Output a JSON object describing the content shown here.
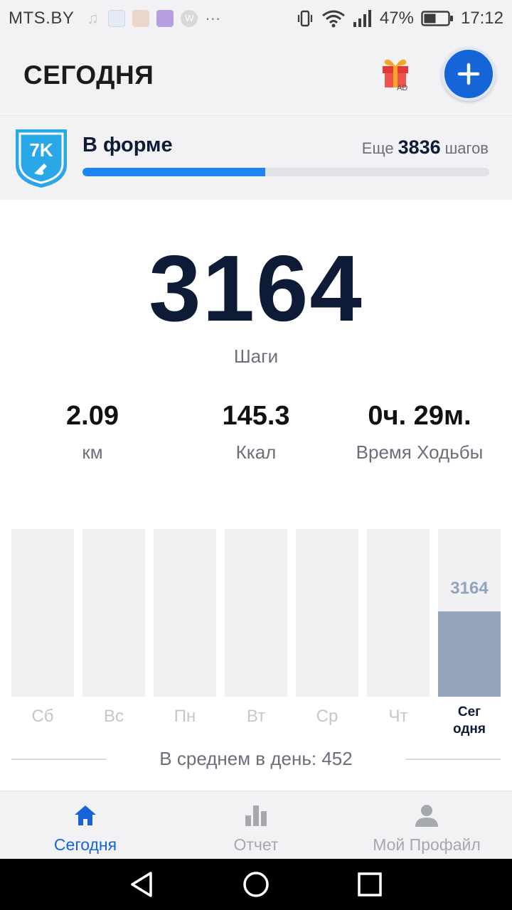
{
  "status_bar": {
    "carrier": "MTS.BY",
    "battery_percent": "47%",
    "time": "17:12",
    "notification_icons": [
      "music-icon",
      "app-icon",
      "photo-icon",
      "gallery-icon",
      "w-icon",
      "more-dots-icon"
    ],
    "system_icons": [
      "vibrate-icon",
      "wifi-icon",
      "signal-icon",
      "battery-icon"
    ]
  },
  "header": {
    "title": "СЕГОДНЯ",
    "gift_badge": "AD",
    "gift_icon": "gift-icon",
    "add_icon": "plus-icon"
  },
  "goal": {
    "badge_text": "7K",
    "name": "В форме",
    "remaining_prefix": "Еще",
    "remaining_steps": "3836",
    "remaining_suffix": "шагов",
    "progress_fraction": 0.45
  },
  "today": {
    "steps": "3164",
    "steps_label": "Шаги",
    "distance_value": "2.09",
    "distance_unit": "км",
    "calories_value": "145.3",
    "calories_unit": "Ккал",
    "walk_time_value": "0ч. 29м.",
    "walk_time_label": "Время Ходьбы"
  },
  "chart_data": {
    "type": "bar",
    "categories": [
      "Сб",
      "Вс",
      "Пн",
      "Вт",
      "Ср",
      "Чт",
      "Сег одня"
    ],
    "category_lines": [
      [
        "Сб"
      ],
      [
        "Вс"
      ],
      [
        "Пн"
      ],
      [
        "Вт"
      ],
      [
        "Ср"
      ],
      [
        "Чт"
      ],
      [
        "Сег",
        "одня"
      ]
    ],
    "values": [
      0,
      0,
      0,
      0,
      0,
      0,
      3164
    ],
    "value_labels": [
      "",
      "",
      "",
      "",
      "",
      "",
      "3164"
    ],
    "ylim": [
      0,
      6200
    ],
    "grid": false,
    "today_index": 6
  },
  "average": {
    "text": "В среднем в день: 452"
  },
  "bottom_nav": [
    {
      "label": "Сегодня",
      "icon": "home-icon",
      "active": true
    },
    {
      "label": "Отчет",
      "icon": "bar-chart-icon",
      "active": false
    },
    {
      "label": "Мой Профайл",
      "icon": "profile-icon",
      "active": false
    }
  ],
  "colors": {
    "accent": "#1565d8",
    "progress": "#1e85f0",
    "bar_today": "#93a3bb",
    "bar_empty": "#f1f1f3",
    "text_dark": "#0d1b36"
  }
}
